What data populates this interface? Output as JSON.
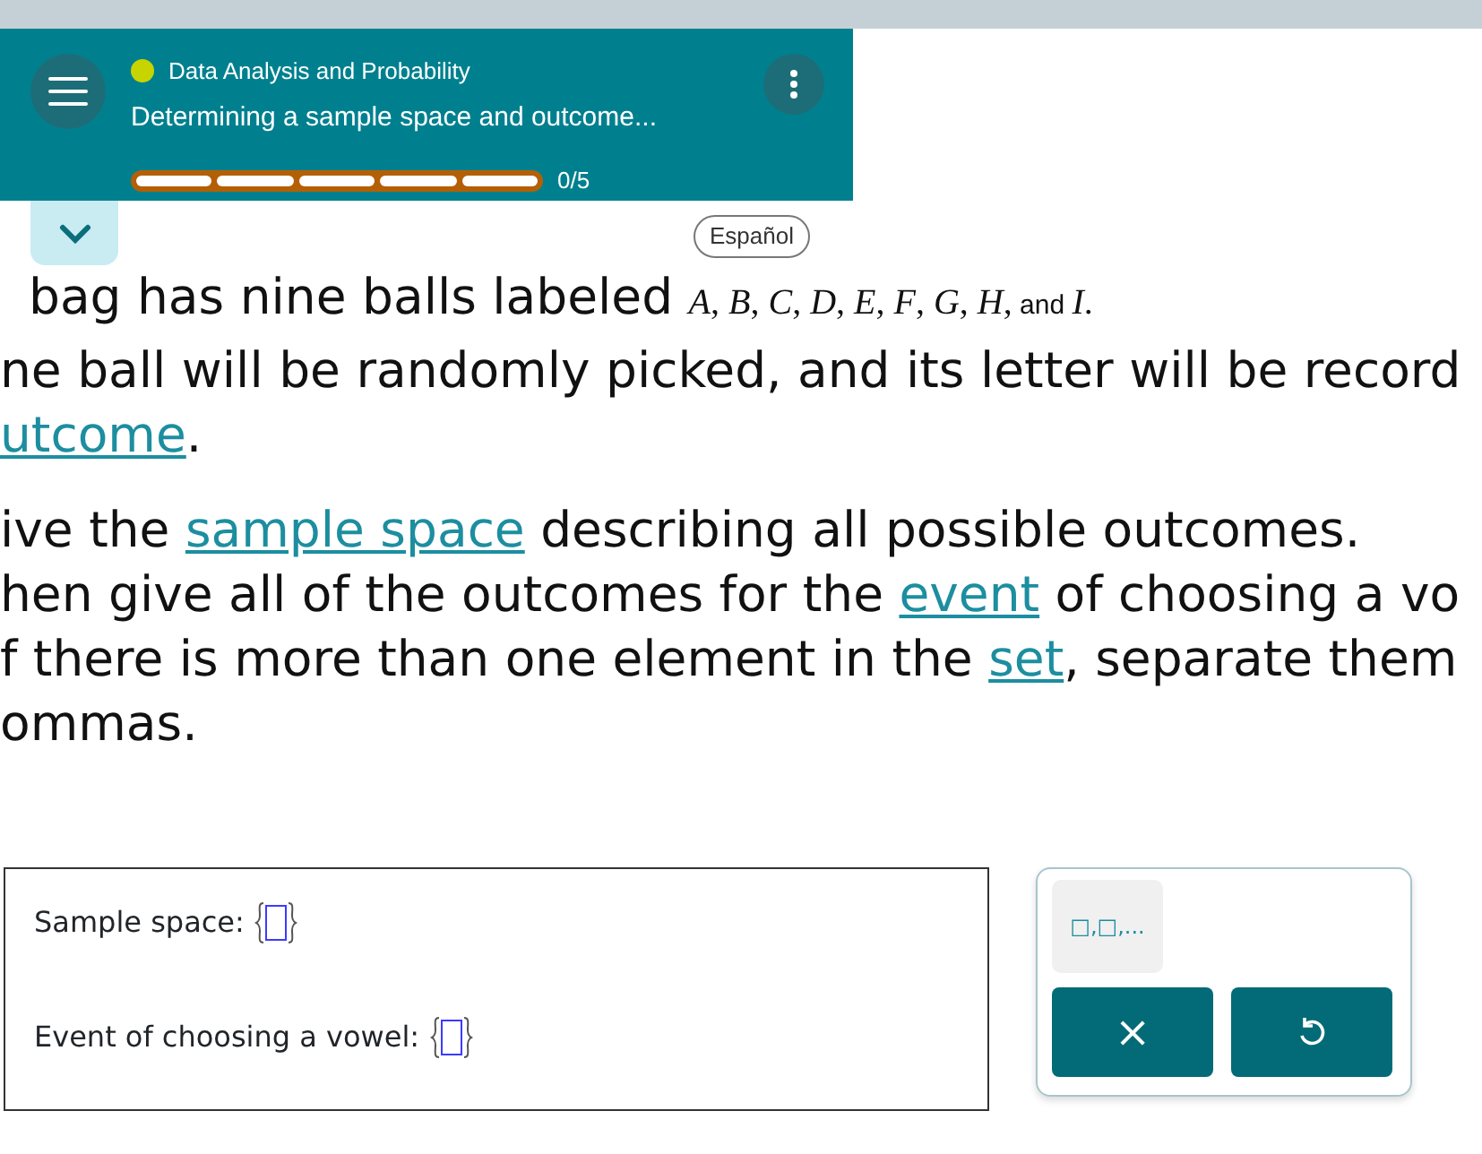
{
  "header": {
    "category": "Data Analysis and Probability",
    "title": "Determining a sample space and outcome...",
    "progress": {
      "segments": [
        {
          "filled": false
        },
        {
          "filled": false
        },
        {
          "filled": false
        },
        {
          "filled": false
        },
        {
          "filled": false
        }
      ],
      "reading": "0/5"
    }
  },
  "language_button": "Español",
  "paragraphs": [
    [
      [
        {
          "kind": "text",
          "text": "bag has nine balls labeled "
        },
        {
          "kind": "math",
          "text": "*A*, *B*, *C*, *D*, *E*, *F*, *G*, *H*,"
        },
        {
          "kind": "mtext",
          "text": " and "
        },
        {
          "kind": "math",
          "text": "*I*."
        }
      ],
      [
        {
          "kind": "text",
          "text": "ne ball will be randomly picked, and its letter will be record"
        }
      ],
      [
        {
          "kind": "term",
          "text": "utcome"
        },
        {
          "kind": "text",
          "text": "."
        }
      ]
    ],
    [
      [
        {
          "kind": "text",
          "text": "ive the "
        },
        {
          "kind": "term",
          "text": "sample space"
        },
        {
          "kind": "text",
          "text": " describing all possible outcomes."
        }
      ],
      [
        {
          "kind": "text",
          "text": "hen give all of the outcomes for the "
        },
        {
          "kind": "term",
          "text": "event"
        },
        {
          "kind": "text",
          "text": " of choosing a vo"
        }
      ],
      [
        {
          "kind": "text",
          "text": "f there is more than one element in the "
        },
        {
          "kind": "term",
          "text": "set"
        },
        {
          "kind": "text",
          "text": ", separate them"
        }
      ],
      [
        {
          "kind": "text",
          "text": "ommas."
        }
      ]
    ]
  ],
  "answers": [
    {
      "label": "Sample space:"
    },
    {
      "label": "Event of choosing a vowel:"
    }
  ],
  "keypad": {
    "template": "□,□,...",
    "clear": "×"
  }
}
